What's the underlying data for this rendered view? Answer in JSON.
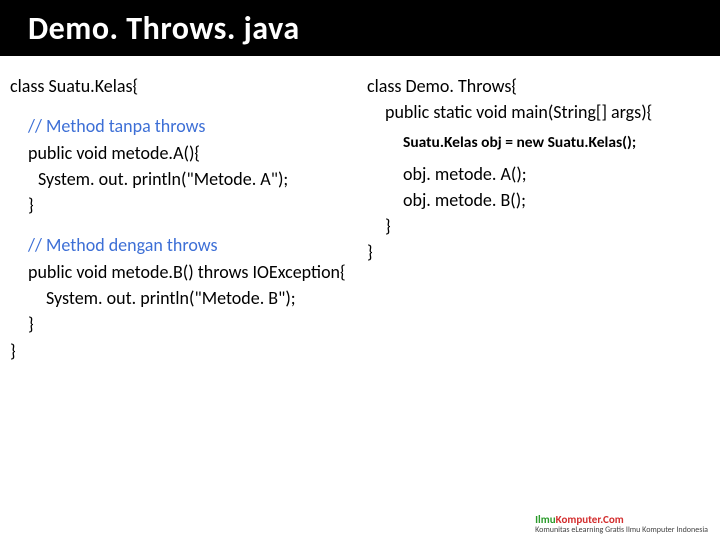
{
  "title": "Demo. Throws. java",
  "left": {
    "l1": "class Suatu.Kelas{",
    "comment1": "// Method tanpa throws",
    "l2": "public void metode.A(){",
    "l3": "System. out. println(\"Metode. A\");",
    "l4": "}",
    "comment2": "// Method dengan throws",
    "l5": "public void metode.B() throws IOException{",
    "l6": "System. out. println(\"Metode. B\");",
    "l7": "}",
    "l8": "}"
  },
  "right": {
    "r1": "class Demo. Throws{",
    "r2": "public static void main(String[] args){",
    "r3": "Suatu.Kelas obj = new Suatu.Kelas();",
    "r4": "obj. metode. A();",
    "r5": "obj. metode. B();",
    "r6": "}",
    "r7": "}"
  },
  "footer": {
    "ilmu": "Ilmu",
    "komputer": "Komputer",
    "com": ".Com",
    "sub": "Komunitas eLearning Gratis Ilmu Komputer Indonesia"
  }
}
